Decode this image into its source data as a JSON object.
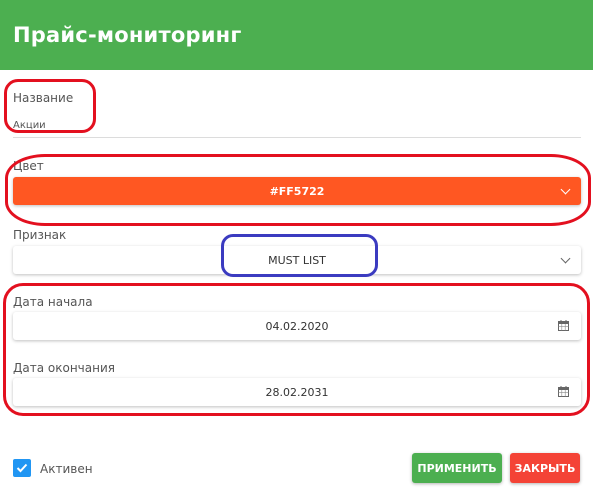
{
  "header": {
    "title": "Прайс-мониторинг"
  },
  "form": {
    "name": {
      "label": "Название",
      "value": "Акции"
    },
    "color": {
      "label": "Цвет",
      "value": "#FF5722",
      "color_hex": "#ff5722"
    },
    "sign": {
      "label": "Признак",
      "value": "MUST LIST"
    },
    "start_date": {
      "label": "Дата начала",
      "value": "04.02.2020"
    },
    "end_date": {
      "label": "Дата окончания",
      "value": "28.02.2031"
    }
  },
  "footer": {
    "active": {
      "label": "Активен",
      "checked": true
    },
    "apply_label": "ПРИМЕНИТЬ",
    "close_label": "ЗАКРЫТЬ"
  },
  "colors": {
    "header": "#4caf50",
    "apply": "#4caf50",
    "close": "#f44336",
    "checkbox": "#2196f3",
    "annotation_red": "#e3101f",
    "annotation_blue": "#3b3bc0"
  },
  "icons": {
    "select_arrow": "chevron-down-icon",
    "date": "calendar-icon",
    "check": "checkmark-icon"
  }
}
